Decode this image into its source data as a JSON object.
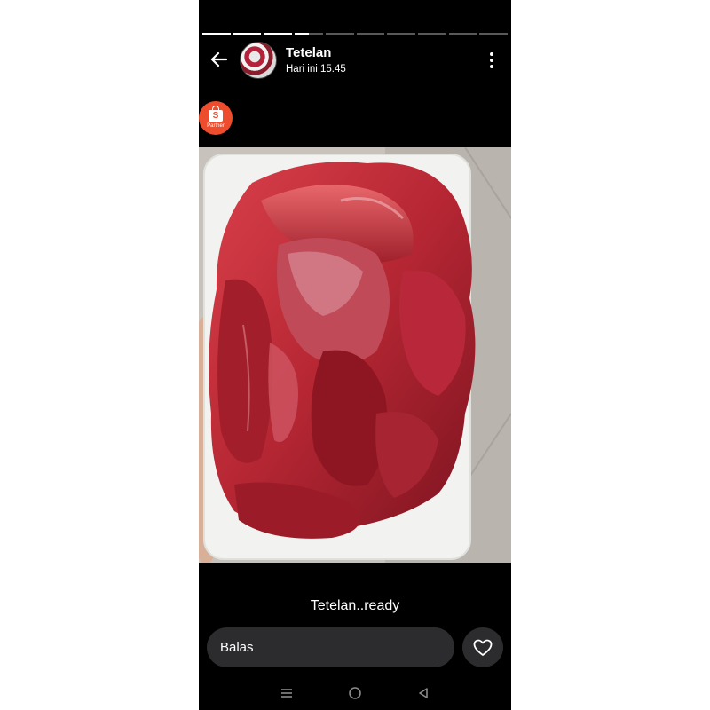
{
  "story": {
    "title": "Tetelan",
    "timestamp": "Hari ini 15.45",
    "caption": "Tetelan..ready",
    "progress": {
      "segments": 10,
      "completed": 3,
      "current_fraction": 0.5
    }
  },
  "badge": {
    "letter": "S",
    "label": "Partner",
    "color": "#ee4d2d"
  },
  "reply": {
    "placeholder": "Balas"
  },
  "icons": {
    "back": "arrow-left-icon",
    "more": "more-vertical-icon",
    "like": "heart-icon",
    "nav_recents": "recents-icon",
    "nav_home": "home-icon",
    "nav_back": "nav-back-icon"
  }
}
